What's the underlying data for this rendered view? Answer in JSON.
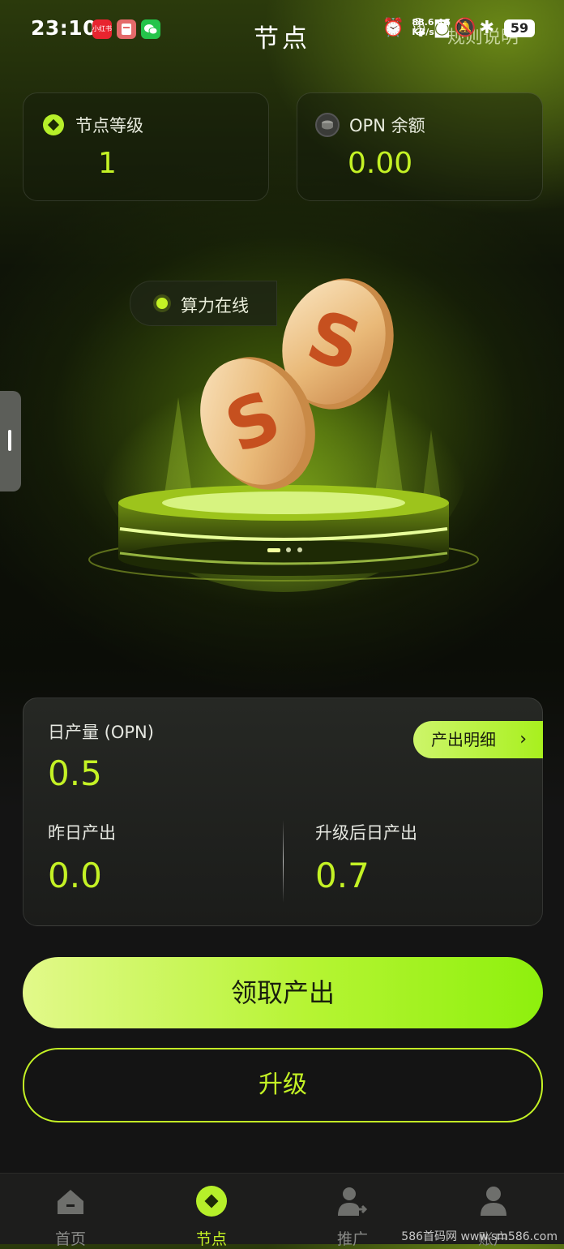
{
  "status_bar": {
    "time": "23:10",
    "network_speed": "88.6",
    "network_unit": "KB/s",
    "network_type": "4G",
    "battery": "59",
    "app_badge_xiaohongshu": "小红书"
  },
  "header": {
    "title": "节点",
    "rules_link": "规则说明"
  },
  "node_level": {
    "label": "节点等级",
    "value": "1"
  },
  "opn_balance": {
    "label": "OPN 余额",
    "value": "0.00"
  },
  "status_pill": {
    "label": "算力在线"
  },
  "production": {
    "daily_label": "日产量 (OPN)",
    "daily_value": "0.5",
    "detail_button": "产出明细",
    "yesterday_label": "昨日产出",
    "yesterday_value": "0.0",
    "after_upgrade_label": "升级后日产出",
    "after_upgrade_value": "0.7"
  },
  "actions": {
    "claim_button": "领取产出",
    "upgrade_button": "升级"
  },
  "tabbar": {
    "items": [
      {
        "label": "首页",
        "icon": "home-icon",
        "active": false
      },
      {
        "label": "节点",
        "icon": "node-icon",
        "active": true
      },
      {
        "label": "推广",
        "icon": "promote-icon",
        "active": false
      },
      {
        "label": "账户",
        "icon": "account-icon",
        "active": false
      }
    ]
  },
  "watermark": "586首码网 www.sm586.com",
  "colors": {
    "accent": "#c4f225",
    "background": "#141414",
    "card": "#1f201e"
  }
}
